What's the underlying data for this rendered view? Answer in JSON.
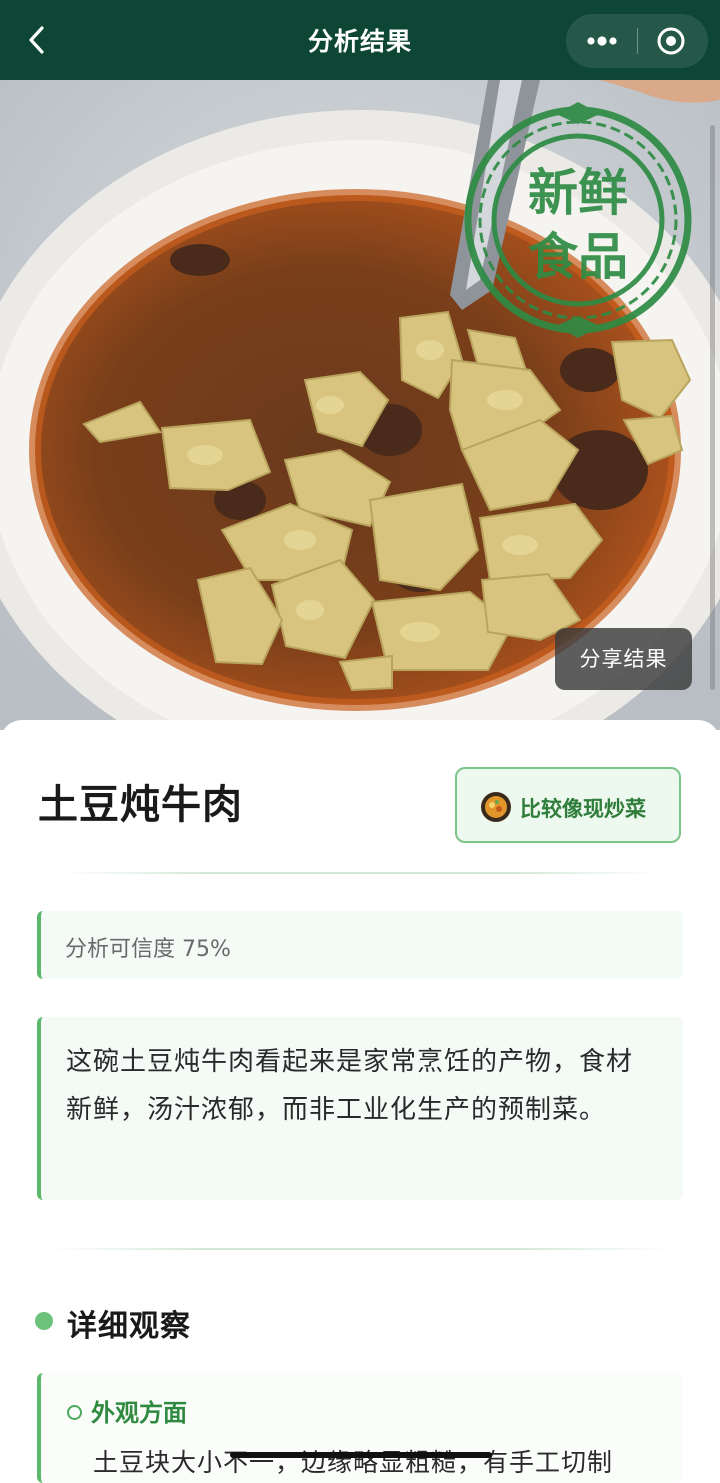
{
  "header": {
    "title": "分析结果"
  },
  "photo": {
    "stamp_text": "新鲜食品",
    "share_label": "分享结果"
  },
  "card": {
    "dish_name": "土豆炖牛肉",
    "verdict_label": "比较像现炒菜",
    "confidence_text": "分析可信度 75%",
    "summary": "这碗土豆炖牛肉看起来是家常烹饪的产物，食材新鲜，汤汁浓郁，而非工业化生产的预制菜。",
    "section_title": "详细观察",
    "observations": [
      {
        "title": "外观方面",
        "text": "土豆块大小不一，边缘略显粗糙，有手工切制"
      }
    ]
  },
  "colors": {
    "header_bg": "#0e4635",
    "accent_green": "#5cb86a",
    "stamp_green": "#2e8b44"
  }
}
